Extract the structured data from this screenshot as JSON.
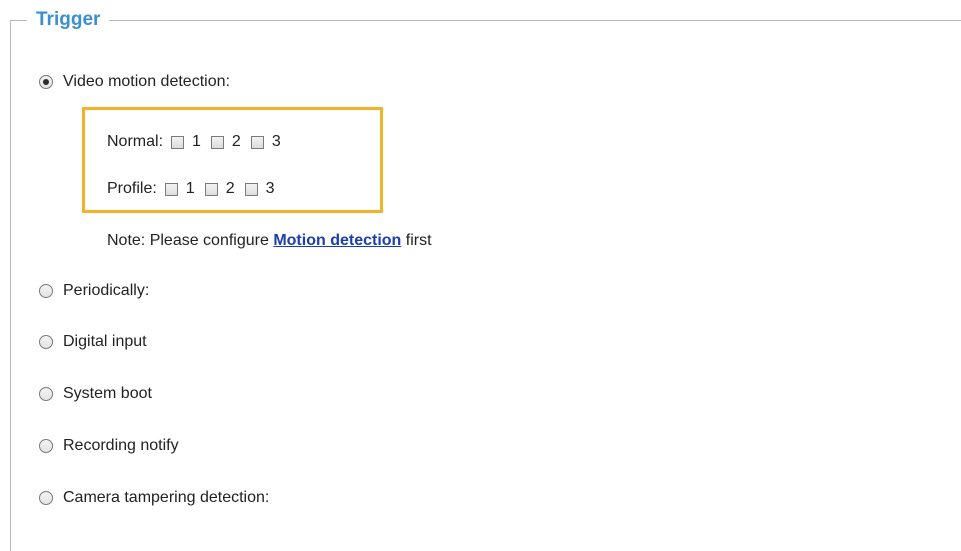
{
  "fieldset": {
    "legend": "Trigger"
  },
  "trigger": {
    "video_motion": {
      "label": "Video motion detection:",
      "checked": true
    },
    "normal": {
      "label": "Normal:",
      "options": [
        "1",
        "2",
        "3"
      ]
    },
    "profile": {
      "label": "Profile:",
      "options": [
        "1",
        "2",
        "3"
      ]
    },
    "note": {
      "prefix": "Note: Please configure ",
      "link": "Motion detection",
      "suffix": " first"
    },
    "periodically": {
      "label": "Periodically:"
    },
    "digital_input": {
      "label": "Digital input"
    },
    "system_boot": {
      "label": "System boot"
    },
    "recording_notify": {
      "label": "Recording notify"
    },
    "camera_tampering": {
      "label": "Camera tampering detection:"
    }
  },
  "colors": {
    "legend": "#3a8fd0",
    "highlight_border": "#f0b32b",
    "link": "#1a3fae",
    "text": "#222222"
  }
}
